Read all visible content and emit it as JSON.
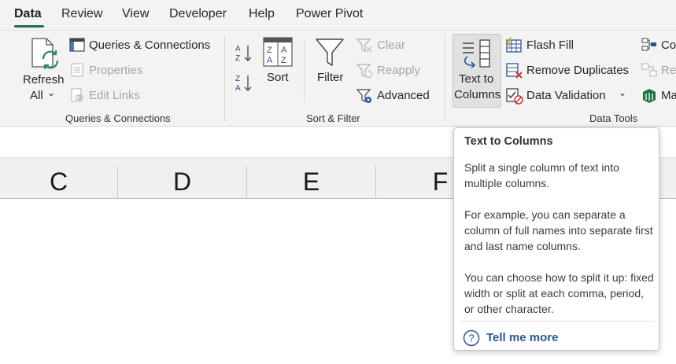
{
  "tabs": [
    "Data",
    "Review",
    "View",
    "Developer",
    "Help",
    "Power Pivot"
  ],
  "active_tab": "Data",
  "ribbon": {
    "refresh_all": [
      "Refresh",
      "All"
    ],
    "queries": {
      "queries_connections": "Queries & Connections",
      "properties": "Properties",
      "edit_links": "Edit Links",
      "group_label": "Queries & Connections"
    },
    "sort_filter": {
      "sort": "Sort",
      "filter": "Filter",
      "clear": "Clear",
      "reapply": "Reapply",
      "advanced": "Advanced",
      "group_label": "Sort & Filter"
    },
    "data_tools": {
      "text_to_columns": [
        "Text to",
        "Columns"
      ],
      "flash_fill": "Flash Fill",
      "remove_duplicates": "Remove Duplicates",
      "data_validation": "Data Validation",
      "consolidate_partial": "Co",
      "relationships_partial": "Rel",
      "manage_partial": "Ma",
      "group_label": "Data Tools"
    }
  },
  "columns": [
    "C",
    "D",
    "E",
    "F"
  ],
  "tooltip": {
    "title": "Text to Columns",
    "para1": "Split a single column of text into multiple columns.",
    "para2": "For example, you can separate a column of full names into separate first and last name columns.",
    "para3": "You can choose how to split it up: fixed width or split at each comma, period, or other character.",
    "tell_me_more": "Tell me more"
  },
  "colors": {
    "accent": "#217346",
    "link": "#2b579a",
    "ribbon_bg": "#f3f3f3"
  },
  "icons": [
    "refresh-icon",
    "queries-connections-icon",
    "properties-icon",
    "edit-links-icon",
    "sort-az-icon",
    "sort-za-icon",
    "sort-icon",
    "filter-icon",
    "clear-filter-icon",
    "reapply-icon",
    "advanced-filter-icon",
    "text-to-columns-icon",
    "flash-fill-icon",
    "remove-duplicates-icon",
    "data-validation-icon",
    "consolidate-icon",
    "relationships-icon",
    "manage-data-model-icon",
    "help-circle-icon"
  ]
}
